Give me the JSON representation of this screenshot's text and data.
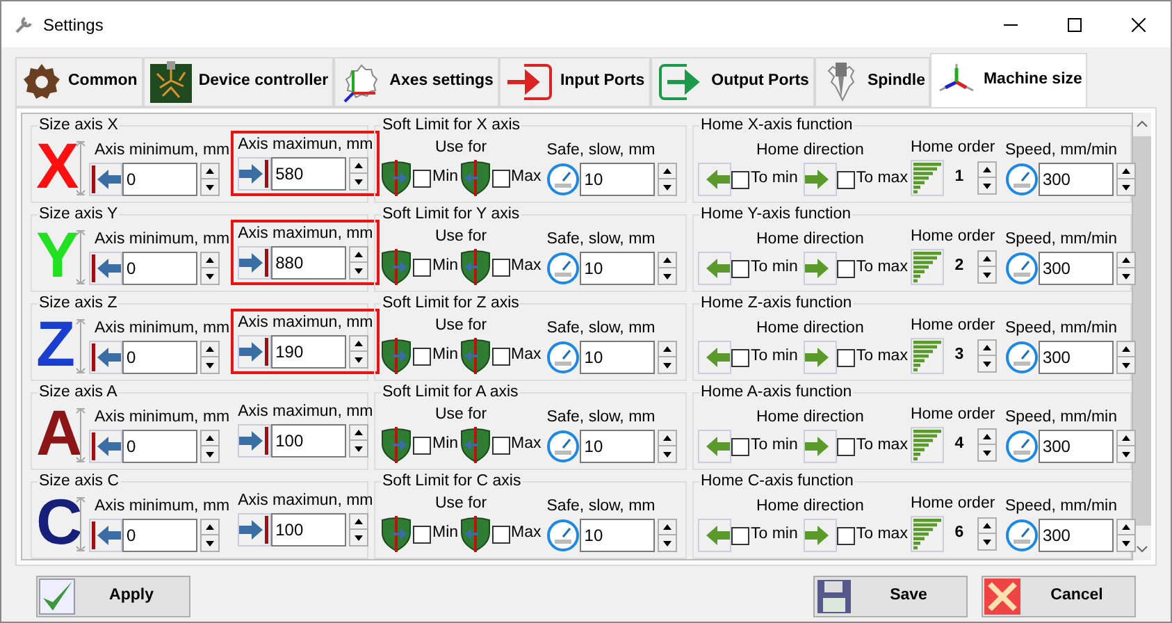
{
  "window": {
    "title": "Settings"
  },
  "tabs": [
    {
      "label": "Common",
      "kind": "gear",
      "selected": false
    },
    {
      "label": "Device controller",
      "kind": "board",
      "selected": false
    },
    {
      "label": "Axes settings",
      "kind": "axes",
      "selected": false
    },
    {
      "label": "Input Ports",
      "kind": "input",
      "selected": false
    },
    {
      "label": "Output Ports",
      "kind": "output",
      "selected": false
    },
    {
      "label": "Spindle",
      "kind": "spindle",
      "selected": false
    },
    {
      "label": "Machine size",
      "kind": "machine",
      "selected": true
    }
  ],
  "axes": [
    {
      "size_title": "Size axis X",
      "letter": "X",
      "color": "#ff1010",
      "min_label": "Axis minimum, mm",
      "min_value": "0",
      "max_label": "Axis maximun, mm",
      "max_value": "580",
      "highlighted": true,
      "soft_title": "Soft Limit for X axis",
      "use_for": "Use for",
      "soft_min": {
        "label": "Min",
        "checked": false
      },
      "soft_max": {
        "label": "Max",
        "checked": false
      },
      "safe_label": "Safe, slow, mm",
      "safe_value": "10",
      "home_title": "Home X-axis function",
      "home_direction": "Home direction",
      "to_min": {
        "label": "To min",
        "checked": false
      },
      "to_max": {
        "label": "To max",
        "checked": false
      },
      "order_label": "Home order",
      "order": "1",
      "speed_label": "Speed, mm/min",
      "speed_value": "300"
    },
    {
      "size_title": "Size axis Y",
      "letter": "Y",
      "color": "#22e022",
      "min_label": "Axis minimum, mm",
      "min_value": "0",
      "max_label": "Axis maximun, mm",
      "max_value": "880",
      "highlighted": true,
      "soft_title": "Soft Limit for Y axis",
      "use_for": "Use for",
      "soft_min": {
        "label": "Min",
        "checked": false
      },
      "soft_max": {
        "label": "Max",
        "checked": false
      },
      "safe_label": "Safe, slow, mm",
      "safe_value": "10",
      "home_title": "Home Y-axis function",
      "home_direction": "Home direction",
      "to_min": {
        "label": "To min",
        "checked": false
      },
      "to_max": {
        "label": "To max",
        "checked": false
      },
      "order_label": "Home order",
      "order": "2",
      "speed_label": "Speed, mm/min",
      "speed_value": "300"
    },
    {
      "size_title": "Size axis Z",
      "letter": "Z",
      "color": "#1a3fd0",
      "min_label": "Axis minimum, mm",
      "min_value": "0",
      "max_label": "Axis maximun, mm",
      "max_value": "190",
      "highlighted": true,
      "soft_title": "Soft Limit for Z axis",
      "use_for": "Use for",
      "soft_min": {
        "label": "Min",
        "checked": false
      },
      "soft_max": {
        "label": "Max",
        "checked": false
      },
      "safe_label": "Safe, slow, mm",
      "safe_value": "10",
      "home_title": "Home Z-axis function",
      "home_direction": "Home direction",
      "to_min": {
        "label": "To min",
        "checked": false
      },
      "to_max": {
        "label": "To max",
        "checked": false
      },
      "order_label": "Home order",
      "order": "3",
      "speed_label": "Speed, mm/min",
      "speed_value": "300"
    },
    {
      "size_title": "Size axis A",
      "letter": "A",
      "color": "#8c1616",
      "min_label": "Axis minimum, mm",
      "min_value": "0",
      "max_label": "Axis maximun, mm",
      "max_value": "100",
      "highlighted": false,
      "soft_title": "Soft Limit for A axis",
      "use_for": "Use for",
      "soft_min": {
        "label": "Min",
        "checked": false
      },
      "soft_max": {
        "label": "Max",
        "checked": false
      },
      "safe_label": "Safe, slow, mm",
      "safe_value": "10",
      "home_title": "Home A-axis function",
      "home_direction": "Home direction",
      "to_min": {
        "label": "To min",
        "checked": false
      },
      "to_max": {
        "label": "To max",
        "checked": false
      },
      "order_label": "Home order",
      "order": "4",
      "speed_label": "Speed, mm/min",
      "speed_value": "300"
    },
    {
      "size_title": "Size axis C",
      "letter": "C",
      "color": "#16207a",
      "min_label": "Axis minimum, mm",
      "min_value": "0",
      "max_label": "Axis maximun, mm",
      "max_value": "100",
      "highlighted": false,
      "soft_title": "Soft Limit for C axis",
      "use_for": "Use for",
      "soft_min": {
        "label": "Min",
        "checked": false
      },
      "soft_max": {
        "label": "Max",
        "checked": false
      },
      "safe_label": "Safe, slow, mm",
      "safe_value": "10",
      "home_title": "Home C-axis function",
      "home_direction": "Home direction",
      "to_min": {
        "label": "To min",
        "checked": false
      },
      "to_max": {
        "label": "To max",
        "checked": false
      },
      "order_label": "Home order",
      "order": "6",
      "speed_label": "Speed, mm/min",
      "speed_value": "300"
    }
  ],
  "buttons": [
    {
      "label": "Apply",
      "kind": "apply"
    },
    {
      "label": "Save",
      "kind": "save"
    },
    {
      "label": "Cancel",
      "kind": "cancel"
    }
  ]
}
